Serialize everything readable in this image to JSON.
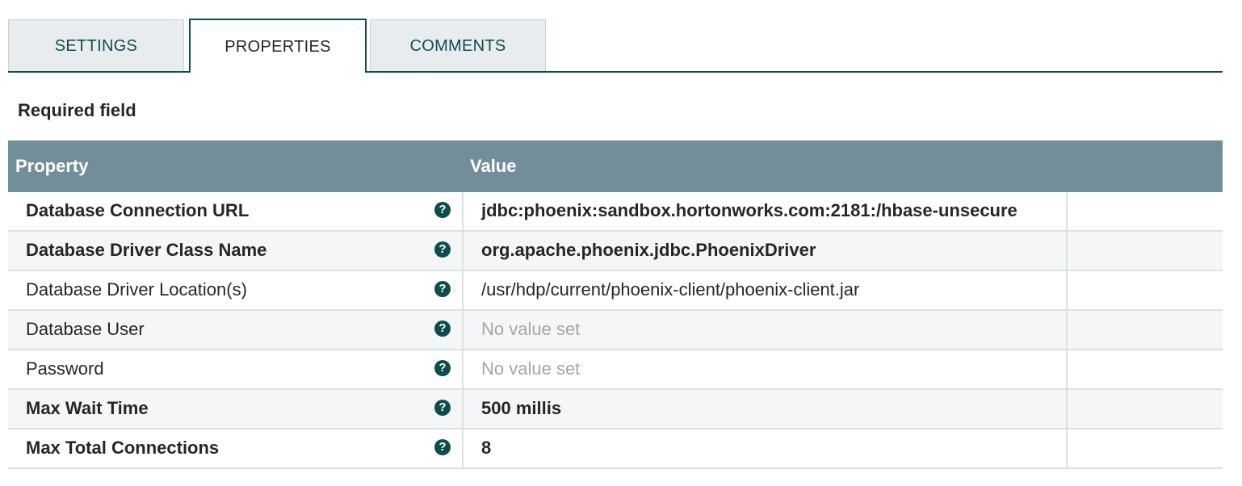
{
  "tabs": [
    {
      "label": "SETTINGS",
      "active": false
    },
    {
      "label": "PROPERTIES",
      "active": true
    },
    {
      "label": "COMMENTS",
      "active": false
    }
  ],
  "required_note": "Required field",
  "table": {
    "headers": {
      "property": "Property",
      "value": "Value"
    },
    "rows": [
      {
        "property": "Database Connection URL",
        "value": "jdbc:phoenix:sandbox.hortonworks.com:2181:/hbase-unsecure",
        "required": true,
        "value_set": true
      },
      {
        "property": "Database Driver Class Name",
        "value": "org.apache.phoenix.jdbc.PhoenixDriver",
        "required": true,
        "value_set": true
      },
      {
        "property": "Database Driver Location(s)",
        "value": "/usr/hdp/current/phoenix-client/phoenix-client.jar",
        "required": false,
        "value_set": true
      },
      {
        "property": "Database User",
        "value": "No value set",
        "required": false,
        "value_set": false
      },
      {
        "property": "Password",
        "value": "No value set",
        "required": false,
        "value_set": false
      },
      {
        "property": "Max Wait Time",
        "value": "500 millis",
        "required": true,
        "value_set": true
      },
      {
        "property": "Max Total Connections",
        "value": "8",
        "required": true,
        "value_set": true
      }
    ],
    "help_icon": "question-circle-icon"
  },
  "colors": {
    "accent": "#0f4d4d",
    "header_bg": "#728e9b",
    "tab_bg": "#e8ecee",
    "unset_text": "#a6a6a6"
  }
}
